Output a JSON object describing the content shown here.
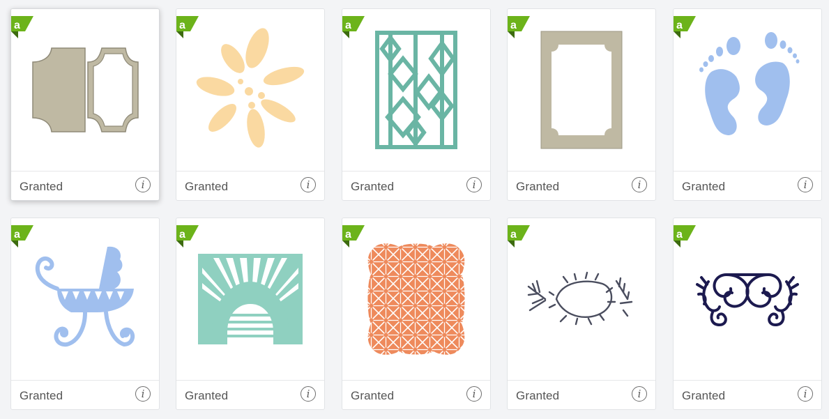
{
  "cards": [
    {
      "status": "Granted",
      "badge": "a",
      "image": "bracket-frame-card"
    },
    {
      "status": "Granted",
      "badge": "a",
      "image": "splash-flower"
    },
    {
      "status": "Granted",
      "badge": "a",
      "image": "diamond-lattice-panel"
    },
    {
      "status": "Granted",
      "badge": "a",
      "image": "scalloped-frame"
    },
    {
      "status": "Granted",
      "badge": "a",
      "image": "baby-footprints"
    },
    {
      "status": "Granted",
      "badge": "a",
      "image": "baby-carriage"
    },
    {
      "status": "Granted",
      "badge": "a",
      "image": "sunrise-panel"
    },
    {
      "status": "Granted",
      "badge": "a",
      "image": "geometric-lace-panel"
    },
    {
      "status": "Granted",
      "badge": "a",
      "image": "branch-wreath"
    },
    {
      "status": "Granted",
      "badge": "a",
      "image": "scroll-flourish"
    }
  ],
  "colors": {
    "badge_green": "#6cb31a",
    "taupe": "#bfb9a3",
    "peach": "#fad9a1",
    "teal": "#6ab5a4",
    "sky": "#a0bfee",
    "mint": "#8fd0c0",
    "coral": "#ee8a5c",
    "slate": "#4a4d5e",
    "navy": "#1c1a4f"
  }
}
